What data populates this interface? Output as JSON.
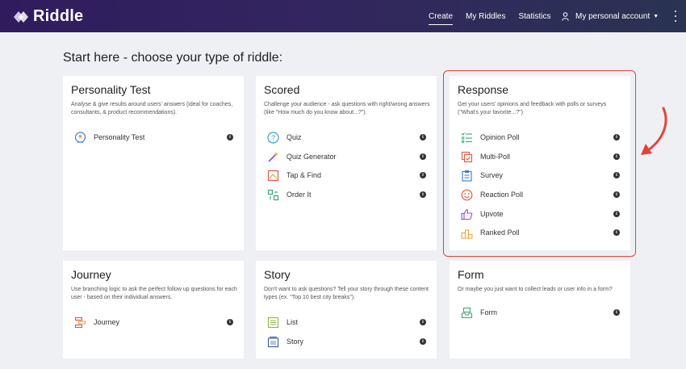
{
  "nav": {
    "brand": "Riddle",
    "links": [
      {
        "label": "Create",
        "active": true
      },
      {
        "label": "My Riddles",
        "active": false
      },
      {
        "label": "Statistics",
        "active": false
      }
    ],
    "account_label": "My personal account"
  },
  "page_title": "Start here - choose your type of riddle:",
  "cards": {
    "personality": {
      "title": "Personality Test",
      "desc": "Analyse & give results around users' answers (ideal for coaches, consultants, & product recommendations).",
      "items": [
        "Personality Test"
      ]
    },
    "scored": {
      "title": "Scored",
      "desc": "Challenge your audience - ask questions with right/wrong answers (like \"How much do you know about...?\").",
      "items": [
        "Quiz",
        "Quiz Generator",
        "Tap & Find",
        "Order It"
      ]
    },
    "response": {
      "title": "Response",
      "desc": "Get your users' opinions and feedback with polls or surveys (\"What's your favorite...?\")",
      "items": [
        "Opinion Poll",
        "Multi-Poll",
        "Survey",
        "Reaction Poll",
        "Upvote",
        "Ranked Poll"
      ]
    },
    "journey": {
      "title": "Journey",
      "desc": "Use branching logic to ask the perfect follow up questions for each user - based on their individual answers.",
      "items": [
        "Journey"
      ]
    },
    "story": {
      "title": "Story",
      "desc": "Don't want to ask questions? Tell your story through these content types (ex. \"Top 10 best city breaks\").",
      "items": [
        "List",
        "Story"
      ]
    },
    "form": {
      "title": "Form",
      "desc": "Or maybe you just want to collect leads or user info in a form?",
      "items": [
        "Form"
      ]
    }
  },
  "info_glyph": "i",
  "colors": {
    "nav_gradient_start": "#2f1c5e",
    "nav_gradient_end": "#2a3352",
    "highlight": "#e0443a",
    "icon_green": "#3aa876",
    "icon_purple": "#8b4fd8",
    "icon_red": "#e05a4b",
    "icon_orange": "#f0a640",
    "icon_blue": "#3a7bd5"
  }
}
